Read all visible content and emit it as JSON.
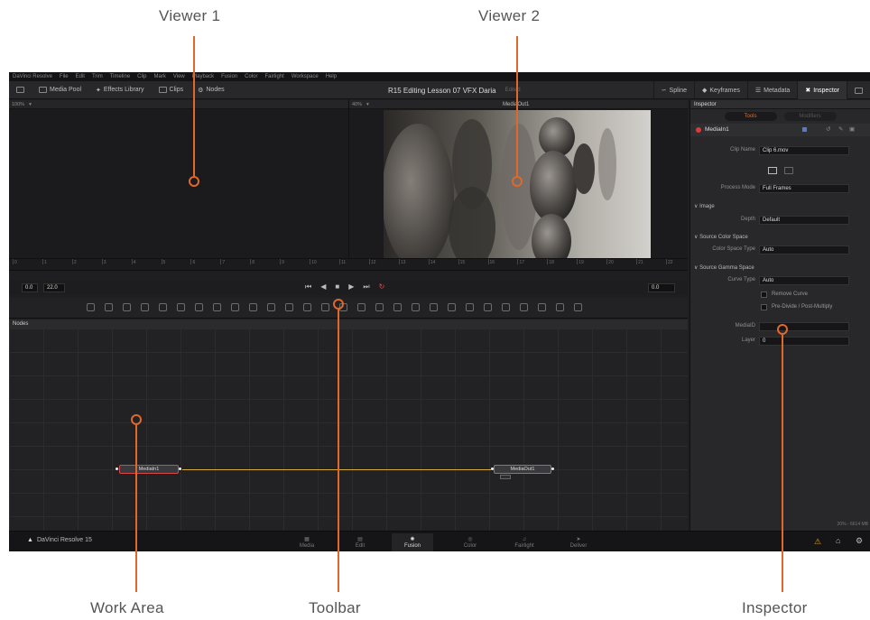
{
  "callouts": {
    "viewer1": "Viewer 1",
    "viewer2": "Viewer 2",
    "work_area": "Work Area",
    "toolbar": "Toolbar",
    "inspector": "Inspector"
  },
  "menu": [
    "DaVinci Resolve",
    "File",
    "Edit",
    "Trim",
    "Timeline",
    "Clip",
    "Mark",
    "View",
    "Playback",
    "Fusion",
    "Color",
    "Fairlight",
    "Workspace",
    "Help"
  ],
  "topbar": {
    "media_pool": "Media Pool",
    "effects_library": "Effects Library",
    "clips": "Clips",
    "nodes": "Nodes",
    "project_title": "R15 Editing Lesson 07 VFX Daria",
    "project_status": "Edited",
    "spline": "Spline",
    "keyframes": "Keyframes",
    "metadata": "Metadata",
    "inspector": "Inspector"
  },
  "viewer": {
    "zoom_left": "100%",
    "zoom_right": "40%",
    "viewer2_title": "MediaOut1"
  },
  "ruler_ticks": [
    "0",
    "1",
    "2",
    "3",
    "4",
    "5",
    "6",
    "7",
    "8",
    "9",
    "10",
    "11",
    "12",
    "13",
    "14",
    "15",
    "16",
    "17",
    "18",
    "19",
    "20",
    "21",
    "22"
  ],
  "playback": {
    "current": "0.0",
    "end": "22.0",
    "right_value": "0.0"
  },
  "nodes_panel": {
    "title": "Nodes",
    "node_in": "MediaIn1",
    "node_out": "MediaOut1"
  },
  "inspector": {
    "title": "Inspector",
    "tab_tools": "Tools",
    "tab_modifiers": "Modifiers",
    "node_name": "MediaIn1",
    "clip_name_label": "Clip Name",
    "clip_name_value": "Clip 6.mov",
    "process_mode_label": "Process Mode",
    "process_mode_value": "Full Frames",
    "image_section": "Image",
    "depth_label": "Depth",
    "depth_value": "Default",
    "source_color_space_section": "Source Color Space",
    "color_space_type_label": "Color Space Type",
    "color_space_type_value": "Auto",
    "source_gamma_space_section": "Source Gamma Space",
    "curve_type_label": "Curve Type",
    "curve_type_value": "Auto",
    "remove_curve": "Remove Curve",
    "pre_divide": "Pre-Divide / Post-Multiply",
    "media_id_label": "MediaID",
    "layer_label": "Layer",
    "layer_value": "0"
  },
  "status": {
    "brand": "DaVinci Resolve 15",
    "memory": "20% - 6614 MB",
    "pages": [
      "Media",
      "Edit",
      "Fusion",
      "Color",
      "Fairlight",
      "Deliver"
    ],
    "active_page": "Fusion"
  },
  "colors": {
    "accent": "#e0682a",
    "link": "#d6ad3a",
    "panel": "#1f1f21"
  }
}
